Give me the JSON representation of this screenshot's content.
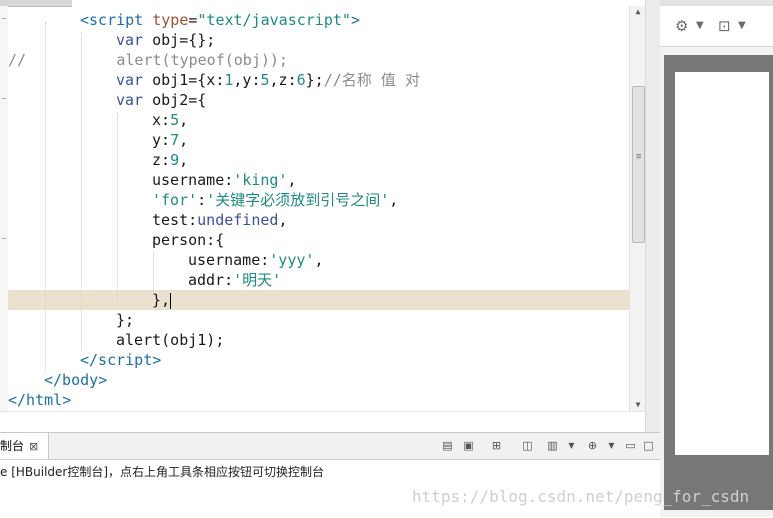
{
  "editor": {
    "lines": [
      {
        "segments": [
          {
            "text": "<script",
            "cls": "tag"
          },
          {
            "text": " type",
            "cls": "attr"
          },
          {
            "text": "=",
            "cls": ""
          },
          {
            "text": "\"text/javascript\"",
            "cls": "str"
          },
          {
            "text": ">",
            "cls": "tag"
          }
        ]
      },
      {
        "segments": [
          {
            "text": "var",
            "cls": "kw"
          },
          {
            "text": " obj={};",
            "cls": ""
          }
        ]
      },
      {
        "segments": [
          {
            "text": "//          alert(typeof(obj));",
            "cls": "cmt"
          }
        ]
      },
      {
        "segments": [
          {
            "text": "var",
            "cls": "kw"
          },
          {
            "text": " obj1={x:",
            "cls": ""
          },
          {
            "text": "1",
            "cls": "num"
          },
          {
            "text": ",y:",
            "cls": ""
          },
          {
            "text": "5",
            "cls": "num"
          },
          {
            "text": ",z:",
            "cls": ""
          },
          {
            "text": "6",
            "cls": "num"
          },
          {
            "text": "};",
            "cls": ""
          },
          {
            "text": "//名称 值 对",
            "cls": "cmt"
          }
        ]
      },
      {
        "segments": [
          {
            "text": "var",
            "cls": "kw"
          },
          {
            "text": " obj2={",
            "cls": ""
          }
        ]
      },
      {
        "segments": [
          {
            "text": "x:",
            "cls": ""
          },
          {
            "text": "5",
            "cls": "num"
          },
          {
            "text": ",",
            "cls": ""
          }
        ]
      },
      {
        "segments": [
          {
            "text": "y:",
            "cls": ""
          },
          {
            "text": "7",
            "cls": "num"
          },
          {
            "text": ",",
            "cls": ""
          }
        ]
      },
      {
        "segments": [
          {
            "text": "z:",
            "cls": ""
          },
          {
            "text": "9",
            "cls": "num"
          },
          {
            "text": ",",
            "cls": ""
          }
        ]
      },
      {
        "segments": [
          {
            "text": "username:",
            "cls": ""
          },
          {
            "text": "'king'",
            "cls": "str"
          },
          {
            "text": ",",
            "cls": ""
          }
        ]
      },
      {
        "segments": [
          {
            "text": "'for'",
            "cls": "str"
          },
          {
            "text": ":",
            "cls": ""
          },
          {
            "text": "'关键字必须放到引号之间'",
            "cls": "str"
          },
          {
            "text": ",",
            "cls": ""
          }
        ]
      },
      {
        "segments": [
          {
            "text": "test:",
            "cls": ""
          },
          {
            "text": "undefined",
            "cls": "kw"
          },
          {
            "text": ",",
            "cls": ""
          }
        ]
      },
      {
        "segments": [
          {
            "text": "person:{",
            "cls": ""
          }
        ]
      },
      {
        "segments": [
          {
            "text": "username:",
            "cls": ""
          },
          {
            "text": "'yyy'",
            "cls": "str"
          },
          {
            "text": ",",
            "cls": ""
          }
        ]
      },
      {
        "segments": [
          {
            "text": "addr:",
            "cls": ""
          },
          {
            "text": "'明天'",
            "cls": "str"
          }
        ]
      },
      {
        "segments": [
          {
            "text": "},",
            "cls": ""
          }
        ]
      },
      {
        "segments": [
          {
            "text": "};",
            "cls": ""
          }
        ]
      },
      {
        "segments": [
          {
            "text": "alert(obj1);",
            "cls": ""
          }
        ]
      },
      {
        "segments": [
          {
            "text": "</script",
            "cls": "tag"
          },
          {
            "text": ">",
            "cls": "tag"
          }
        ]
      },
      {
        "segments": [
          {
            "text": "</body",
            "cls": "tag"
          },
          {
            "text": ">",
            "cls": "tag"
          }
        ]
      },
      {
        "segments": [
          {
            "text": "</html",
            "cls": "tag"
          },
          {
            "text": ">",
            "cls": "tag"
          }
        ]
      }
    ]
  },
  "console": {
    "tab_label": "制台",
    "close_glyph": "⊠",
    "message": "e [HBuilder控制台]，点右上角工具条相应按钮可切换控制台",
    "toolbar_icons": [
      "clear-console-icon",
      "lock-icon",
      "pin-icon",
      "display-icon",
      "dropdown-icon",
      "new-console-icon",
      "dropdown-icon",
      "minimize-icon",
      "maximize-icon"
    ]
  },
  "browser": {
    "toolbar_icons": [
      "gear-icon",
      "chevron-down-icon",
      "console-icon",
      "dropdown-icon"
    ]
  },
  "watermark": "https://blog.csdn.net/peng_for_csdn",
  "colors": {
    "tag": "#1b6fa8",
    "attr": "#a0522d",
    "string": "#1f8a80",
    "keyword": "#3a4fa0",
    "comment": "#8c8c8c",
    "current_line": "#e8e2cf"
  }
}
